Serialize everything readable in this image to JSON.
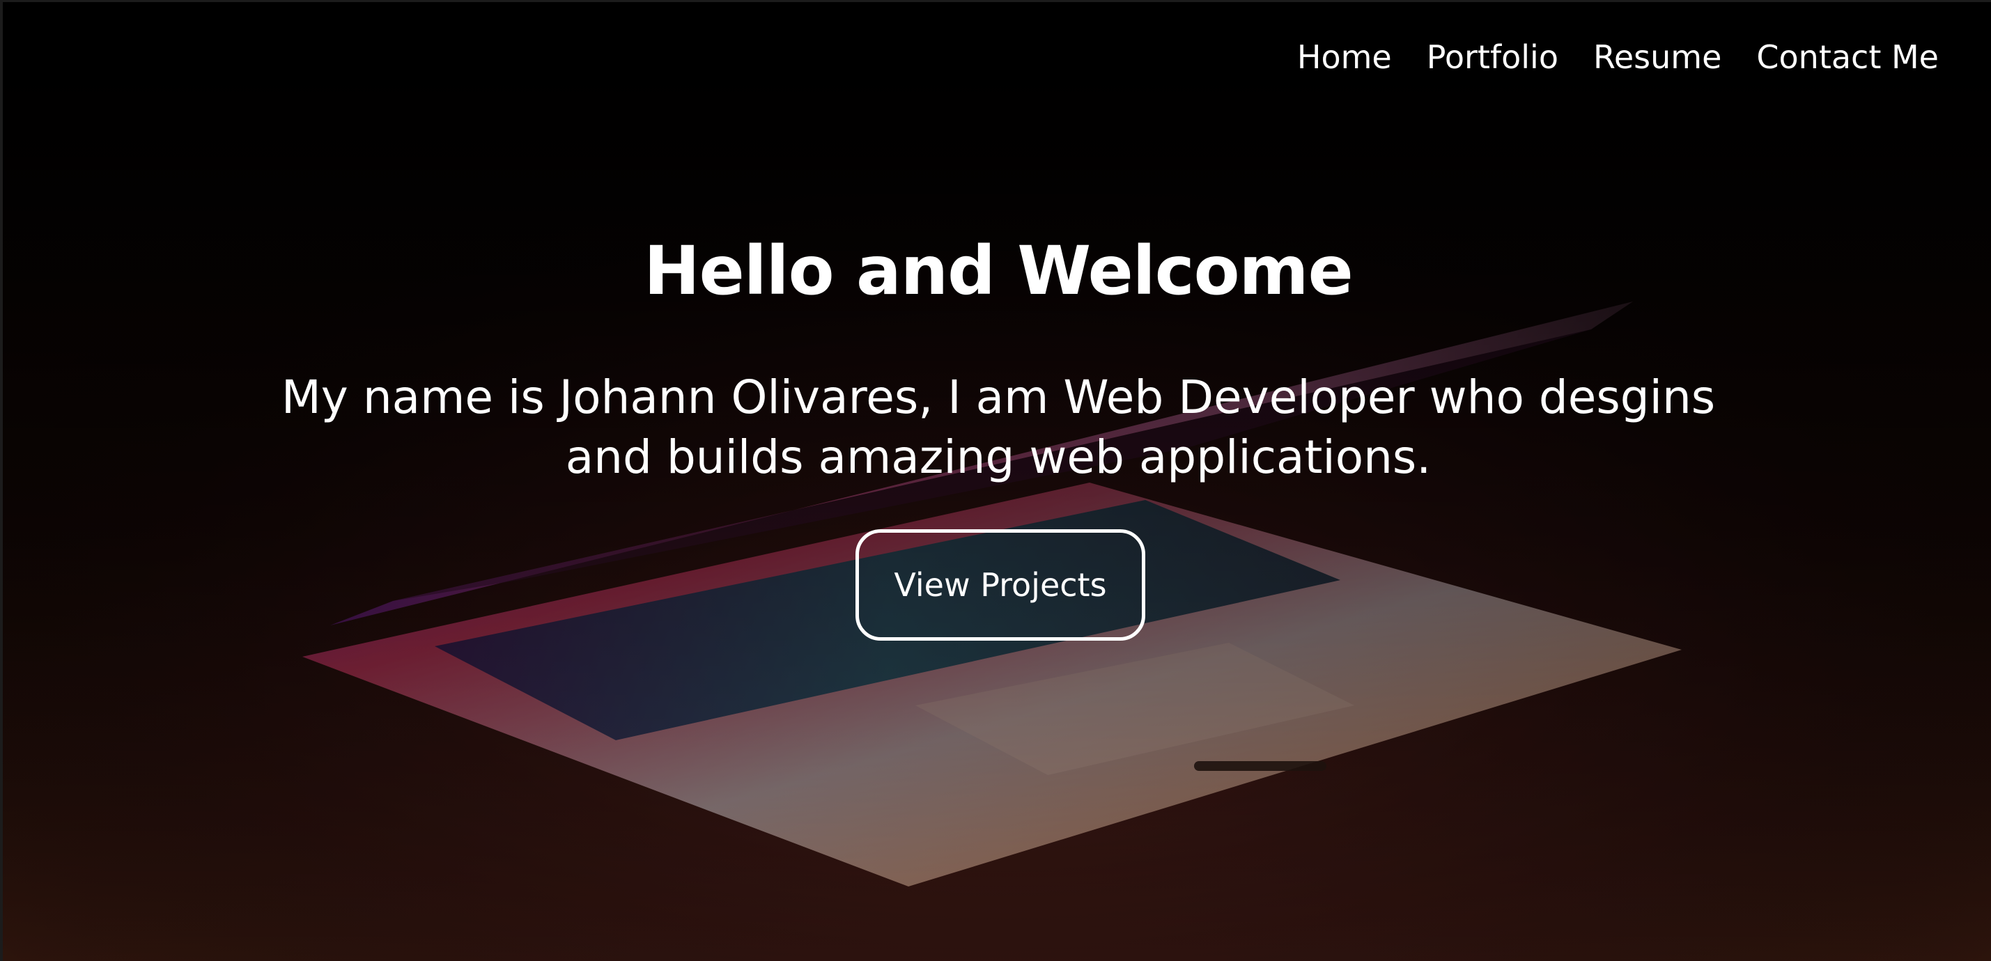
{
  "nav": {
    "items": [
      {
        "label": "Home"
      },
      {
        "label": "Portfolio"
      },
      {
        "label": "Resume"
      },
      {
        "label": "Contact Me"
      }
    ]
  },
  "hero": {
    "title": "Hello and Welcome",
    "subtitle": "My name is Johann Olivares, I am Web Developer who desgins and builds amazing web applications.",
    "cta_label": "View Projects",
    "background": "laptop-photo"
  },
  "colors": {
    "background": "#000000",
    "text": "#ffffff",
    "button_border": "#ffffff"
  }
}
